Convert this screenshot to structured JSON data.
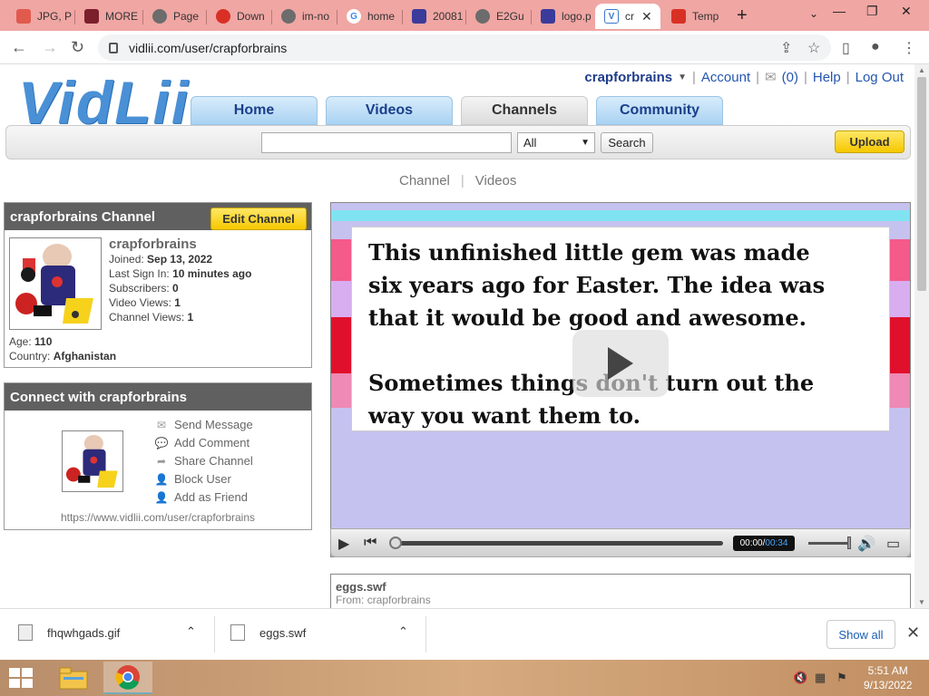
{
  "browser": {
    "tabs": [
      {
        "label": "JPG, P",
        "color": "#e05a4e",
        "glyph": "✦"
      },
      {
        "label": "MORE",
        "color": "#7b1f2b",
        "glyph": "★"
      },
      {
        "label": "Page",
        "color": "#6c6c6c",
        "glyph": "◉"
      },
      {
        "label": "Down",
        "color": "#d93025",
        "glyph": "⊘"
      },
      {
        "label": "im-no",
        "color": "#6c6c6c",
        "glyph": "◉"
      },
      {
        "label": "home",
        "color": "#4285f4",
        "glyph": "G"
      },
      {
        "label": "20081",
        "color": "#3b3b9b",
        "glyph": "✚"
      },
      {
        "label": "E2Gu",
        "color": "#6c6c6c",
        "glyph": "◉"
      },
      {
        "label": "logo.p",
        "color": "#3b3b9b",
        "glyph": "✚"
      },
      {
        "label": "cr",
        "color": "#3b78c8",
        "glyph": "V"
      },
      {
        "label": "Temp",
        "color": "#d93025",
        "glyph": "✉"
      }
    ],
    "url": "vidlii.com/user/crapforbrains"
  },
  "site": {
    "logo": "VidLii",
    "user": "crapforbrains",
    "account": "Account",
    "inbox": "(0)",
    "help": "Help",
    "logout": "Log Out",
    "nav": [
      "Home",
      "Videos",
      "Channels",
      "Community"
    ],
    "nav_active": "Channels",
    "search_select": "All",
    "search_button": "Search",
    "upload": "Upload",
    "subnav": [
      "Channel",
      "Videos"
    ]
  },
  "channel": {
    "title": "crapforbrains Channel",
    "edit_button": "Edit Channel",
    "name": "crapforbrains",
    "joined_label": "Joined:",
    "joined": "Sep 13, 2022",
    "signin_label": "Last Sign In:",
    "signin": "10 minutes ago",
    "subs_label": "Subscribers:",
    "subs": "0",
    "vviews_label": "Video Views:",
    "vviews": "1",
    "cviews_label": "Channel Views:",
    "cviews": "1",
    "age_label": "Age:",
    "age": "110",
    "country_label": "Country:",
    "country": "Afghanistan"
  },
  "connect": {
    "title": "Connect with crapforbrains",
    "links": [
      "Send Message",
      "Add Comment",
      "Share Channel",
      "Block User",
      "Add as Friend"
    ],
    "url": "https://www.vidlii.com/user/crapforbrains"
  },
  "video": {
    "line1": "This unfinished little gem was made",
    "line2": "six years ago for Easter. The idea was",
    "line3": "that it would be good and awesome.",
    "line4": "Sometimes things don't turn out the",
    "line5": "way you want them to.",
    "time_current": "00:00",
    "time_sep": " / ",
    "time_total": "00:34",
    "progress": 0,
    "file": "eggs.swf",
    "from_label": "From:",
    "from": "crapforbrains"
  },
  "downloads": {
    "items": [
      "fhqwhgads.gif",
      "eggs.swf"
    ],
    "show_all": "Show all"
  },
  "taskbar": {
    "time": "5:51 AM",
    "date": "9/13/2022"
  }
}
